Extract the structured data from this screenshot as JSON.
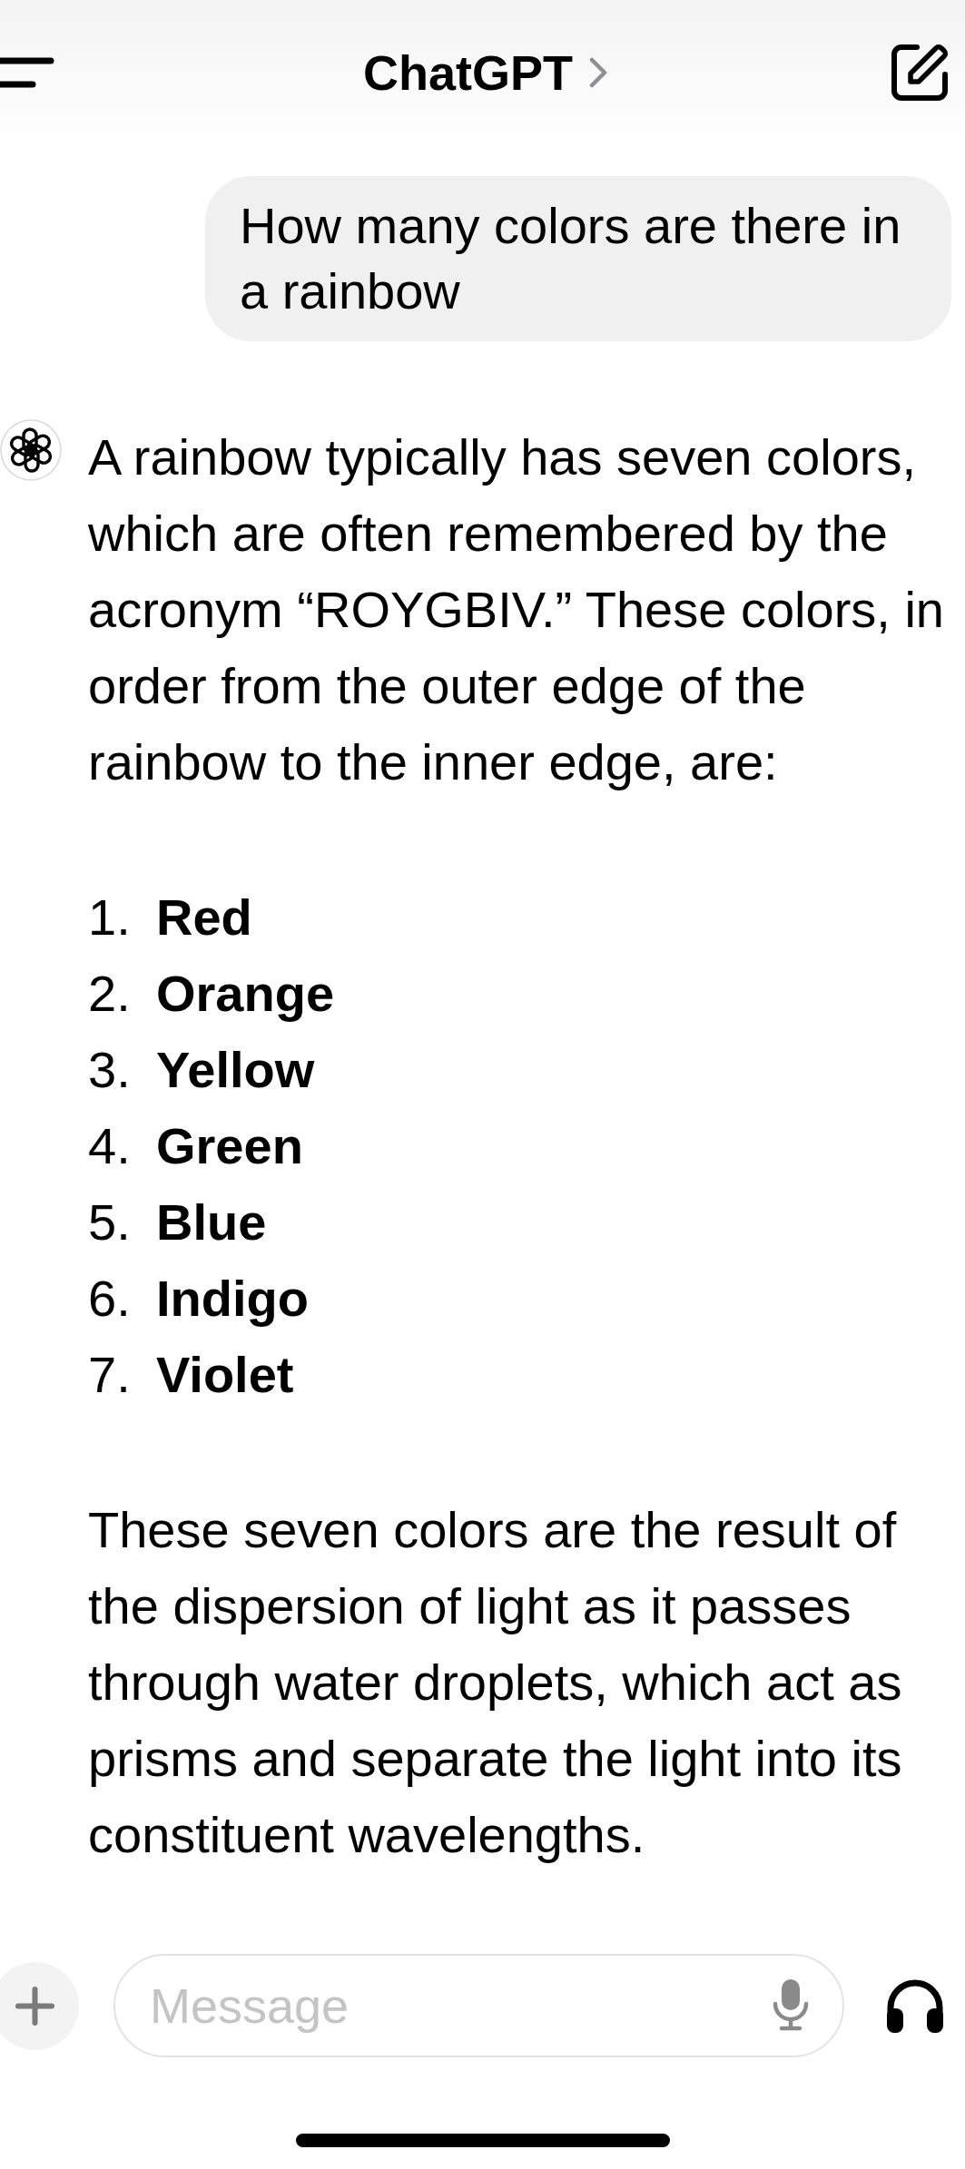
{
  "header": {
    "title": "ChatGPT"
  },
  "messages": [
    {
      "kind": "user",
      "text": "How many colors are there in a rainbow"
    },
    {
      "kind": "assistant",
      "blocks": [
        {
          "kind": "paragraph",
          "text": "A rainbow typically has seven colors, which are often remembered by the acronym “ROYGBIV.” These colors, in order from the outer edge of the rainbow to the inner edge, are:"
        },
        {
          "kind": "list",
          "items": [
            {
              "number": "1.",
              "label": "Red"
            },
            {
              "number": "2.",
              "label": "Orange"
            },
            {
              "number": "3.",
              "label": "Yellow"
            },
            {
              "number": "4.",
              "label": "Green"
            },
            {
              "number": "5.",
              "label": "Blue"
            },
            {
              "number": "6.",
              "label": "Indigo"
            },
            {
              "number": "7.",
              "label": "Violet"
            }
          ]
        },
        {
          "kind": "paragraph",
          "text": "These seven colors are the result of the dispersion of light as it passes through water droplets, which act as prisms and separate the light into its constituent wavelengths."
        }
      ]
    }
  ],
  "composer": {
    "placeholder": "Message"
  }
}
